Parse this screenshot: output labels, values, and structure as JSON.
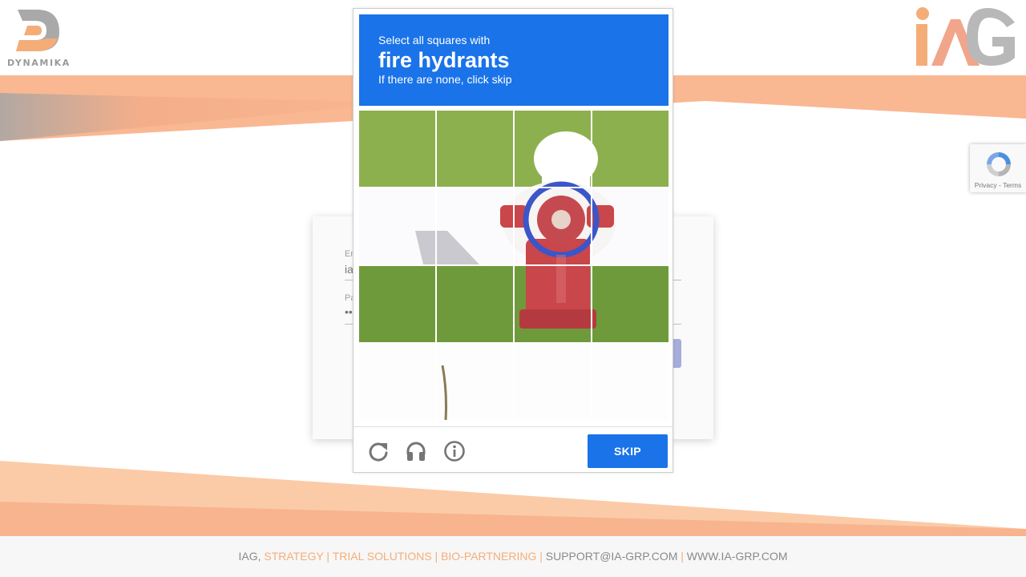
{
  "colors": {
    "brand_orange": "#f5ad78",
    "captcha_blue": "#1a73e8",
    "login_button": "#a7acdc",
    "footer_text": "#8a8a8a"
  },
  "header": {
    "left_logo_text": "DYNAMIKA",
    "left_logo_icon": "dynamika-d-logo",
    "right_logo_icon": "iag-logo"
  },
  "login": {
    "email_label": "Em",
    "email_value": "ia",
    "password_label": "Pa",
    "password_value": "••"
  },
  "recaptcha_badge": {
    "links": "Privacy - Terms",
    "icon": "recaptcha-icon"
  },
  "captcha": {
    "instruction_line1": "Select all squares with",
    "target_object": "fire hydrants",
    "instruction_line3": "If there are none, click skip",
    "grid_rows": 4,
    "grid_cols": 4,
    "footer_icons": [
      "reload-icon",
      "audio-icon",
      "info-icon"
    ],
    "skip_label": "SKIP"
  },
  "footer": {
    "prefix": "IAG, ",
    "links_accent": "STRATEGY | TRIAL SOLUTIONS | BIO-PARTNERING |",
    "email": " SUPPORT@IA-GRP.COM ",
    "separator": "|",
    "website": " WWW.IA-GRP.COM"
  }
}
